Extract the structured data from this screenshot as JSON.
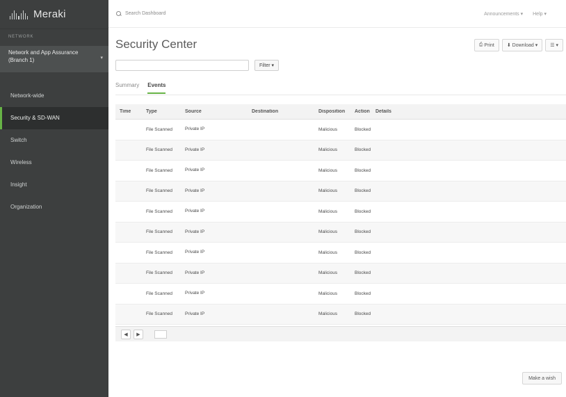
{
  "app": {
    "brand": "Meraki"
  },
  "sidebar": {
    "section_label": "NETWORK",
    "network": "Network and App Assurance (Branch 1)",
    "items": [
      {
        "label": "Network-wide",
        "active": false
      },
      {
        "label": "Security & SD-WAN",
        "active": true
      },
      {
        "label": "Switch",
        "active": false
      },
      {
        "label": "Wireless",
        "active": false
      },
      {
        "label": "Insight",
        "active": false
      },
      {
        "label": "Organization",
        "active": false
      }
    ]
  },
  "topbar": {
    "search_label": "Search Dashboard",
    "announcements": "Announcements",
    "help": "Help",
    "user": ""
  },
  "page": {
    "title": "Security Center",
    "range": "",
    "actions": {
      "print": "Print",
      "download": "Download"
    },
    "search_placeholder": "",
    "filter_label": "Filter",
    "match_count": "",
    "tabs": [
      "Summary",
      "Events"
    ]
  },
  "table": {
    "headers": [
      "Time",
      "Type",
      "Source",
      "Destination",
      "Disposition",
      "Action",
      "Details"
    ],
    "rows": [
      {
        "time": "",
        "type": "File Scanned",
        "source": "Private IP",
        "source_sub": "",
        "dest": "",
        "dest_sub": "",
        "disposition": "Malicious",
        "action": "Blocked",
        "det_a": "",
        "det_b": ""
      },
      {
        "time": "",
        "type": "File Scanned",
        "source": "Private IP",
        "source_sub": "",
        "dest": "",
        "dest_sub": "",
        "disposition": "Malicious",
        "action": "Blocked",
        "det_a": "",
        "det_b": ""
      },
      {
        "time": "",
        "type": "File Scanned",
        "source": "Private IP",
        "source_sub": "",
        "dest": "",
        "dest_sub": "",
        "disposition": "Malicious",
        "action": "Blocked",
        "det_a": "",
        "det_b": ""
      },
      {
        "time": "",
        "type": "File Scanned",
        "source": "Private IP",
        "source_sub": "",
        "dest": "",
        "dest_sub": "",
        "disposition": "Malicious",
        "action": "Blocked",
        "det_a": "",
        "det_b": ""
      },
      {
        "time": "",
        "type": "File Scanned",
        "source": "Private IP",
        "source_sub": "",
        "dest": "",
        "dest_sub": "",
        "disposition": "Malicious",
        "action": "Blocked",
        "det_a": "",
        "det_b": ""
      },
      {
        "time": "",
        "type": "File Scanned",
        "source": "Private IP",
        "source_sub": "",
        "dest": "",
        "dest_sub": "",
        "disposition": "Malicious",
        "action": "Blocked",
        "det_a": "",
        "det_b": ""
      },
      {
        "time": "",
        "type": "File Scanned",
        "source": "Private IP",
        "source_sub": "",
        "dest": "",
        "dest_sub": "",
        "disposition": "Malicious",
        "action": "Blocked",
        "det_a": "",
        "det_b": ""
      },
      {
        "time": "",
        "type": "File Scanned",
        "source": "Private IP",
        "source_sub": "",
        "dest": "",
        "dest_sub": "",
        "disposition": "Malicious",
        "action": "Blocked",
        "det_a": "",
        "det_b": ""
      },
      {
        "time": "",
        "type": "File Scanned",
        "source": "Private IP",
        "source_sub": "",
        "dest": "",
        "dest_sub": "",
        "disposition": "Malicious",
        "action": "Blocked",
        "det_a": "",
        "det_b": ""
      },
      {
        "time": "",
        "type": "File Scanned",
        "source": "Private IP",
        "source_sub": "",
        "dest": "",
        "dest_sub": "",
        "disposition": "Malicious",
        "action": "Blocked",
        "det_a": "",
        "det_b": ""
      }
    ]
  },
  "pager": {
    "prev": "◀",
    "next": "▶",
    "info": "",
    "rows_per_page": "",
    "rows_label": ""
  },
  "footer": {
    "left_1": "",
    "left_2": "",
    "mid_1": "",
    "mid_2": "",
    "mid_3": "",
    "button": "Make a wish"
  },
  "colors": {
    "accent": "#67b346",
    "sidebar": "#3d3f3f"
  }
}
